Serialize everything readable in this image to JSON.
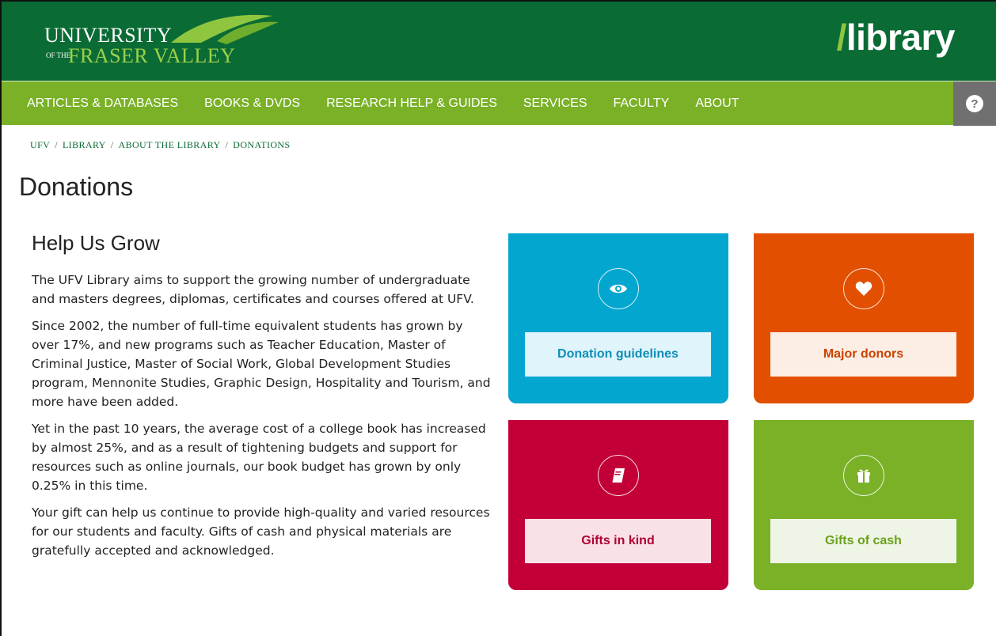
{
  "header": {
    "logo": {
      "line1": "UNIVERSITY",
      "line2_prefix": "OF THE",
      "line2": "FRASER VALLEY"
    },
    "library_mark": {
      "slash": "/",
      "word": "library"
    }
  },
  "nav": {
    "items": [
      {
        "label": "ARTICLES & DATABASES"
      },
      {
        "label": "BOOKS & DVDS"
      },
      {
        "label": "RESEARCH HELP & GUIDES"
      },
      {
        "label": "SERVICES"
      },
      {
        "label": "FACULTY"
      },
      {
        "label": "ABOUT"
      }
    ],
    "help_label": "?"
  },
  "breadcrumb": {
    "items": [
      "UFV",
      "LIBRARY",
      "ABOUT THE LIBRARY",
      "DONATIONS"
    ],
    "separator": "/"
  },
  "page": {
    "title": "Donations",
    "section_title": "Help Us Grow",
    "paragraphs": [
      "The UFV Library aims to support the growing number of undergraduate and masters degrees, diplomas, certificates and courses offered at UFV.",
      "Since 2002, the number of full-time equivalent students has grown by over 17%, and new programs such as Teacher Education, Master of Criminal Justice, Master of Social Work, Global Development Studies program, Mennonite Studies, Graphic Design, Hospitality and Tourism, and more have been added.",
      "Yet in the past 10 years, the average cost of a college book has increased by almost 25%, and as a result of tightening budgets and support for resources such as online journals, our book budget has grown by only 0.25% in this time.",
      "Your gift can help us continue to provide high-quality and varied resources for our students and faculty. Gifts of cash and physical materials are gratefully accepted and acknowledged."
    ]
  },
  "tiles": [
    {
      "label": "Donation guidelines",
      "icon": "eye-icon",
      "color": "#02a6cf"
    },
    {
      "label": "Major donors",
      "icon": "heart-icon",
      "color": "#e34f00"
    },
    {
      "label": "Gifts in kind",
      "icon": "book-icon",
      "color": "#c20037"
    },
    {
      "label": "Gifts of cash",
      "icon": "gift-icon",
      "color": "#7ab127"
    }
  ],
  "colors": {
    "header_green": "#0b6b35",
    "nav_green": "#7ab127",
    "help_gray": "#707070"
  }
}
